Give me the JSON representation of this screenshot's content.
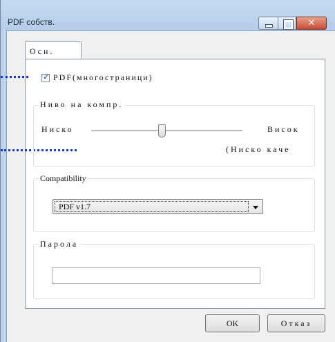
{
  "window": {
    "title": "PDF собств.",
    "close_glyph": "✕"
  },
  "tabs": [
    {
      "label": "Осн."
    }
  ],
  "multipage_checkbox": {
    "label": "PDF(многостраници)",
    "checked": true
  },
  "compression": {
    "group_title": "Ниво на компр.",
    "low_label": "Ниско",
    "high_label": "Висок",
    "quality_note": "(Ниско каче",
    "level": 0.47
  },
  "compatibility": {
    "group_title": "Compatibility",
    "selected": "PDF v1.7"
  },
  "password": {
    "group_title": "Парола",
    "value": ""
  },
  "buttons": {
    "ok": "OK",
    "cancel": "Отказ"
  }
}
